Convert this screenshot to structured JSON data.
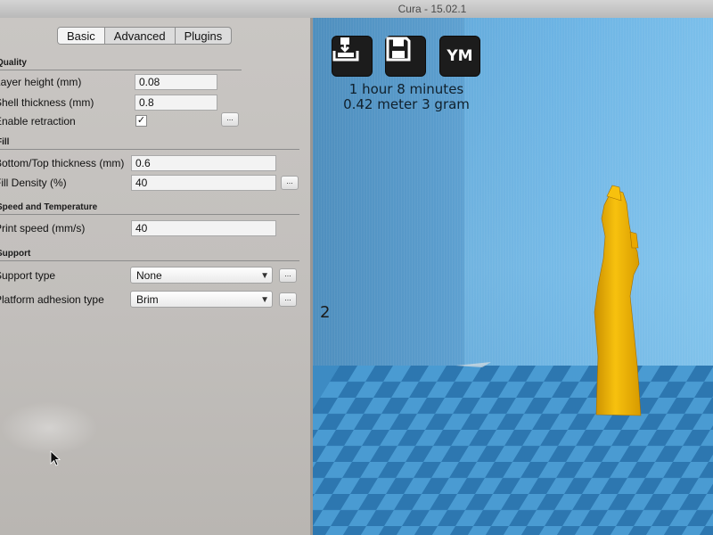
{
  "window": {
    "title": "Cura - 15.02.1"
  },
  "tabs": [
    {
      "label": "Basic",
      "active": true
    },
    {
      "label": "Advanced",
      "active": false
    },
    {
      "label": "Plugins",
      "active": false
    }
  ],
  "sections": {
    "quality": "Quality",
    "fill": "Fill",
    "speed": "Speed and Temperature",
    "support": "Support"
  },
  "quality": {
    "layer_height": {
      "label": "Layer height (mm)",
      "value": "0.08"
    },
    "shell_thickness": {
      "label": "Shell thickness (mm)",
      "value": "0.8"
    },
    "retraction": {
      "label": "Enable retraction",
      "checked": true,
      "check_glyph": "✓",
      "more": "..."
    }
  },
  "fill": {
    "bottom_top": {
      "label": "Bottom/Top thickness (mm)",
      "value": "0.6"
    },
    "density": {
      "label": "Fill Density (%)",
      "value": "40",
      "more": "..."
    }
  },
  "speed": {
    "print_speed": {
      "label": "Print speed (mm/s)",
      "value": "40"
    }
  },
  "support": {
    "support_type": {
      "label": "Support type",
      "value": "None",
      "more": "..."
    },
    "adhesion_type": {
      "label": "Platform adhesion type",
      "value": "Brim",
      "more": "..."
    }
  },
  "viewer": {
    "toolbar": [
      {
        "icon": "print-export-icon"
      },
      {
        "icon": "save-icon"
      },
      {
        "icon": "ym-badge",
        "label": "YM"
      }
    ],
    "estimate_time": "1 hour 8 minutes",
    "estimate_material": "0.42 meter 3 gram",
    "axis_mark": "2",
    "model_color": "#f2b705",
    "plate_light": "#4a9bd2",
    "plate_dark": "#2d77b0"
  }
}
